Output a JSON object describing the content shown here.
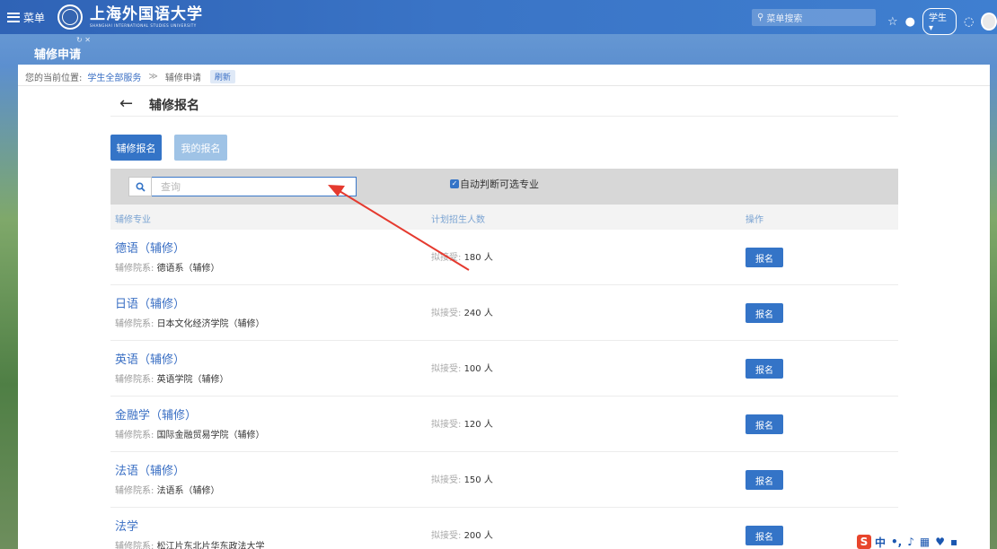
{
  "topbar": {
    "menu_label": "菜单",
    "logo_cn": "上海外国语大学",
    "logo_en": "SHANGHAI INTERNATIONAL STUDIES UNIVERSITY",
    "search_placeholder": "菜单搜索",
    "role": "学生"
  },
  "page_tab": {
    "title": "辅修申请"
  },
  "breadcrumb": {
    "prefix": "您的当前位置:",
    "items": [
      "学生全部服务",
      "辅修申请"
    ],
    "separator": "≫",
    "refresh": "刷新"
  },
  "header": {
    "title": "辅修报名"
  },
  "tabs": [
    {
      "label": "辅修报名"
    },
    {
      "label": "我的报名"
    }
  ],
  "filter": {
    "search_placeholder": "查询",
    "auto_check_label": "自动判断可选专业"
  },
  "table": {
    "columns": [
      "辅修专业",
      "计划招生人数",
      "操作"
    ],
    "dept_prefix": "辅修院系:",
    "plan_prefix": "拟接受:",
    "apply_label": "报名",
    "rows": [
      {
        "major": "德语（辅修）",
        "dept": "德语系（辅修）",
        "plan": "180 人"
      },
      {
        "major": "日语（辅修）",
        "dept": "日本文化经济学院（辅修）",
        "plan": "240 人"
      },
      {
        "major": "英语（辅修）",
        "dept": "英语学院（辅修）",
        "plan": "100 人"
      },
      {
        "major": "金融学（辅修）",
        "dept": "国际金融贸易学院（辅修）",
        "plan": "120 人"
      },
      {
        "major": "法语（辅修）",
        "dept": "法语系（辅修）",
        "plan": "150 人"
      },
      {
        "major": "法学",
        "dept": "松江片东北片华东政法大学",
        "plan": "200 人"
      }
    ]
  },
  "tray": {
    "ime_logo": "S",
    "ime_mode": "中"
  },
  "colors": {
    "primary": "#3474c7",
    "link": "#3a6fc4",
    "annotation_arrow": "#e53a2f"
  }
}
